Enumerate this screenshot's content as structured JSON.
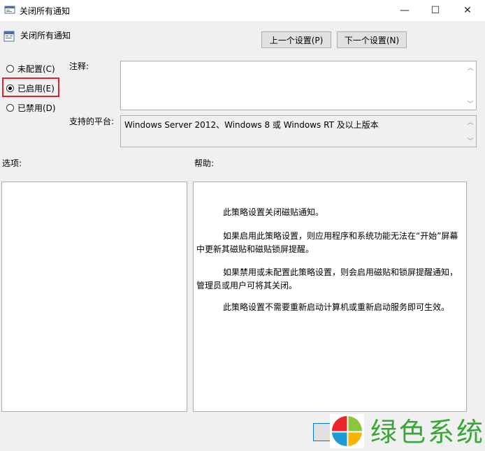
{
  "window": {
    "title": "关闭所有通知",
    "minimize": "—",
    "maximize": "☐",
    "close": "✕"
  },
  "header": {
    "title": "关闭所有通知",
    "prev_button": "上一个设置(P)",
    "next_button": "下一个设置(N)"
  },
  "state": {
    "options": [
      {
        "label": "未配置(C)",
        "checked": false
      },
      {
        "label": "已启用(E)",
        "checked": true
      },
      {
        "label": "已禁用(D)",
        "checked": false
      }
    ]
  },
  "comment": {
    "label": "注释:",
    "value": ""
  },
  "platform": {
    "label": "支持的平台:",
    "value": "Windows Server 2012、Windows 8 或 Windows RT 及以上版本"
  },
  "options_panel": {
    "label": "选项:"
  },
  "help_panel": {
    "label": "帮助:",
    "paragraphs": [
      "此策略设置关闭磁贴通知。",
      "如果启用此策略设置，则应用程序和系统功能无法在“开始”屏幕中更新其磁贴和磁贴锁屏提醒。",
      "如果禁用或未配置此策略设置，则会启用磁贴和锁屏提醒通知，管理员或用户可将其关闭。",
      "此策略设置不需要重新启动计算机或重新启动服务即可生效。"
    ]
  },
  "watermark": {
    "text": "绿色系统"
  },
  "colors": {
    "highlight": "#e0202a",
    "watermark": "#3aa639"
  }
}
